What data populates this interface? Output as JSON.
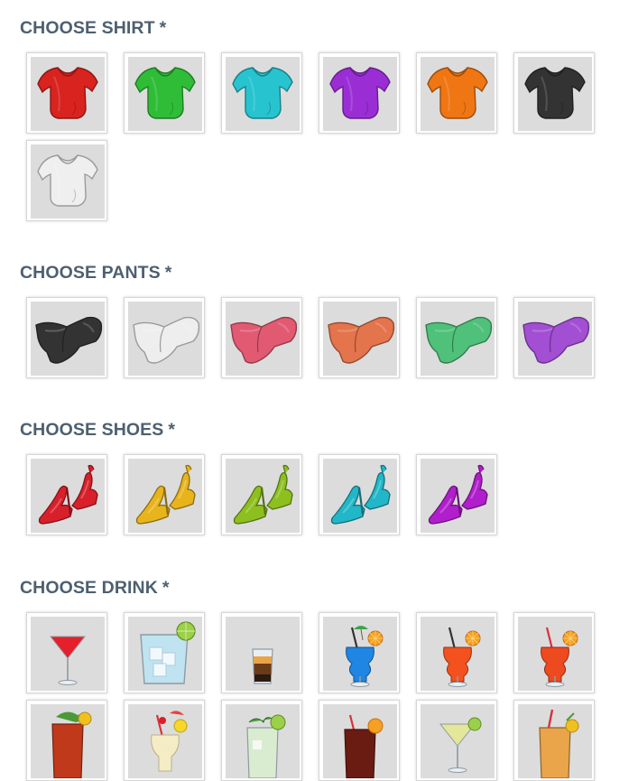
{
  "sections": {
    "shirt": {
      "title": "CHOOSE SHIRT",
      "required_mark": "*",
      "options": [
        {
          "icon": "shirt-icon",
          "color": "#d8231f"
        },
        {
          "icon": "shirt-icon",
          "color": "#2fbd38"
        },
        {
          "icon": "shirt-icon",
          "color": "#27c4cf"
        },
        {
          "icon": "shirt-icon",
          "color": "#9a2ed4"
        },
        {
          "icon": "shirt-icon",
          "color": "#ef7613"
        },
        {
          "icon": "shirt-icon",
          "color": "#333333"
        },
        {
          "icon": "shirt-icon",
          "color": "#efefef"
        }
      ]
    },
    "pants": {
      "title": "CHOOSE PANTS",
      "required_mark": "*",
      "options": [
        {
          "icon": "pants-icon",
          "color": "#333333"
        },
        {
          "icon": "pants-icon",
          "color": "#eeeeee"
        },
        {
          "icon": "pants-icon",
          "color": "#e15a72"
        },
        {
          "icon": "pants-icon",
          "color": "#e4744c"
        },
        {
          "icon": "pants-icon",
          "color": "#4fc17a"
        },
        {
          "icon": "pants-icon",
          "color": "#a24fd3"
        }
      ]
    },
    "shoes": {
      "title": "CHOOSE SHOES",
      "required_mark": "*",
      "options": [
        {
          "icon": "high-heel-shoes-icon",
          "color": "#d8202a"
        },
        {
          "icon": "high-heel-shoes-icon",
          "color": "#e8b41c"
        },
        {
          "icon": "high-heel-shoes-icon",
          "color": "#8dc01e"
        },
        {
          "icon": "high-heel-shoes-icon",
          "color": "#22b7c8"
        },
        {
          "icon": "high-heel-shoes-icon",
          "color": "#b01fcb"
        }
      ]
    },
    "drink": {
      "title": "CHOOSE DRINK",
      "required_mark": "*",
      "options": [
        {
          "icon": "cosmopolitan-cocktail-icon",
          "color": "#e3202c"
        },
        {
          "icon": "gin-and-tonic-icon",
          "color": "#bfe3f0"
        },
        {
          "icon": "layered-shot-icon",
          "color": "#6b3a18"
        },
        {
          "icon": "blue-hurricane-cocktail-icon",
          "color": "#1f86e3"
        },
        {
          "icon": "orange-hurricane-cocktail-icon",
          "color": "#f3521f"
        },
        {
          "icon": "red-hurricane-cocktail-icon",
          "color": "#ee4a20"
        },
        {
          "icon": "iced-tea-cocktail-icon",
          "color": "#c0391b"
        },
        {
          "icon": "pina-colada-icon",
          "color": "#f3ecc5"
        },
        {
          "icon": "mojito-icon",
          "color": "#d9ecd0"
        },
        {
          "icon": "cola-drink-icon",
          "color": "#6a1c12"
        },
        {
          "icon": "martini-icon",
          "color": "#e4e79a"
        },
        {
          "icon": "amber-cocktail-icon",
          "color": "#eaa44a"
        }
      ]
    }
  }
}
